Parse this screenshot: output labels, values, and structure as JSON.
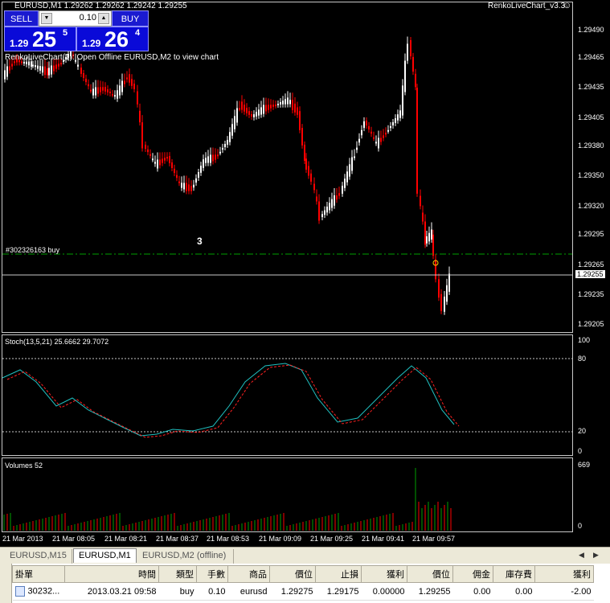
{
  "header": {
    "symbol_info": "EURUSD,M1  1.29262 1.29262 1.29242 1.29255",
    "renko_title": "RenkoLiveChart_v3.3",
    "smiley": "☺",
    "renko_text": "RenkoLiveChart(1): Open Offline EURUSD,M2 to view chart",
    "order_label": "#302326163 buy",
    "renko_count": "3"
  },
  "one_click": {
    "sell_label": "SELL",
    "buy_label": "BUY",
    "lot": "0.10",
    "down_arrow": "▼",
    "up_arrow": "▲",
    "sell_prefix": "1.29",
    "sell_big": "25",
    "sell_sup": "5",
    "buy_prefix": "1.29",
    "buy_big": "26",
    "buy_sup": "4"
  },
  "price_axis": {
    "labels": [
      "1.29490",
      "1.29465",
      "1.29435",
      "1.29405",
      "1.29380",
      "1.29350",
      "1.29320",
      "1.29295",
      "1.29265",
      "1.29235",
      "1.29205"
    ],
    "current": "1.29255"
  },
  "stoch": {
    "label": "Stoch(13,5,21) 25.6662 29.7072",
    "levels": [
      "100",
      "80",
      "20",
      "0"
    ]
  },
  "volumes": {
    "label": "Volumes 52",
    "levels": [
      "669",
      "0"
    ]
  },
  "time_axis": [
    "21 Mar 2013",
    "21 Mar 08:05",
    "21 Mar 08:21",
    "21 Mar 08:37",
    "21 Mar 08:53",
    "21 Mar 09:09",
    "21 Mar 09:25",
    "21 Mar 09:41",
    "21 Mar 09:57"
  ],
  "tabs": [
    {
      "label": "EURUSD,M15",
      "active": false
    },
    {
      "label": "EURUSD,M1",
      "active": true
    },
    {
      "label": "EURUSD,M2 (offline)",
      "active": false
    }
  ],
  "tab_nav": {
    "prev": "◀",
    "next": "▶"
  },
  "terminal": {
    "columns": [
      "掛單",
      "時間",
      "類型",
      "手數",
      "商品",
      "價位",
      "止損",
      "獲利",
      "價位",
      "佣金",
      "庫存費",
      "獲利"
    ],
    "rows": [
      [
        "30232...",
        "2013.03.21 09:58",
        "buy",
        "0.10",
        "eurusd",
        "1.29275",
        "1.29175",
        "0.00000",
        "1.29255",
        "0.00",
        "0.00",
        "-2.00"
      ]
    ]
  },
  "colors": {
    "bull": "#ffffff",
    "bear": "#ff0000",
    "stoch_main": "#20c0c0",
    "stoch_signal": "#ff2020",
    "volume": "#00a000",
    "order_line": "#00a000"
  }
}
